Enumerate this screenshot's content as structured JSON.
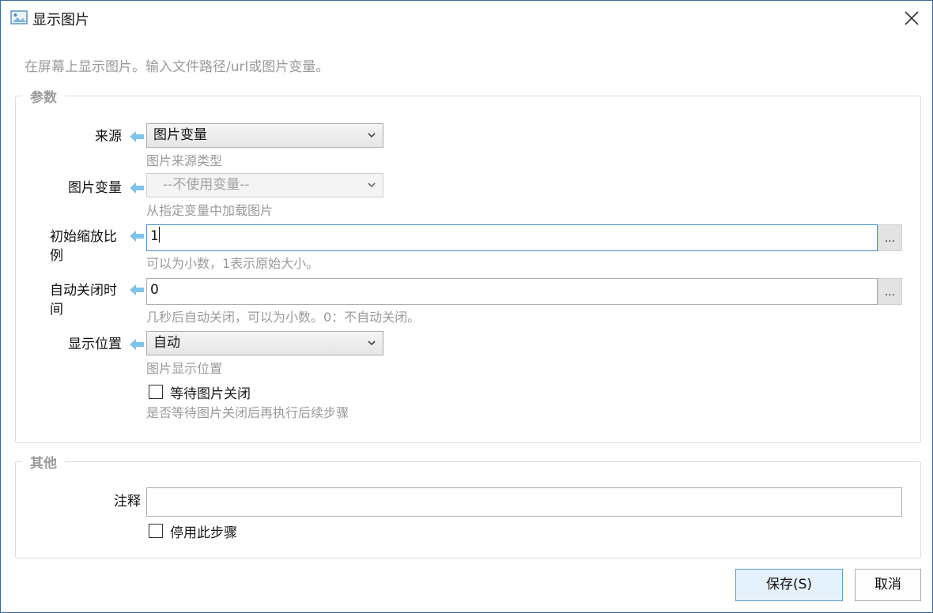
{
  "window": {
    "title": "显示图片",
    "icon": "image-icon"
  },
  "description": "在屏幕上显示图片。输入文件路径/url或图片变量。",
  "params": {
    "legend": "参数",
    "source": {
      "label": "来源",
      "value": "图片变量",
      "hint": "图片来源类型"
    },
    "image_var": {
      "label": "图片变量",
      "value": "--不使用变量--",
      "hint": "从指定变量中加载图片"
    },
    "zoom": {
      "label_line1": "初始缩放比",
      "label_line2": "例",
      "value": "1",
      "hint": "可以为小数，1表示原始大小。",
      "dots": "..."
    },
    "auto_close": {
      "label_line1": "自动关闭时",
      "label_line2": "间",
      "value": "0",
      "hint": "几秒后自动关闭，可以为小数。0：不自动关闭。",
      "dots": "..."
    },
    "position": {
      "label": "显示位置",
      "value": "自动",
      "hint": "图片显示位置"
    },
    "wait_close": {
      "label": "等待图片关闭",
      "hint": "是否等待图片关闭后再执行后续步骤",
      "checked": false
    }
  },
  "other": {
    "legend": "其他",
    "comment": {
      "label": "注释",
      "value": ""
    },
    "disable_step": {
      "label": "停用此步骤",
      "checked": false
    }
  },
  "buttons": {
    "save": "保存(S)",
    "cancel": "取消"
  },
  "colors": {
    "arrow": "#7cc4ea",
    "focus_border": "#4a90d0",
    "primary_bg": "#e5f1fb"
  }
}
